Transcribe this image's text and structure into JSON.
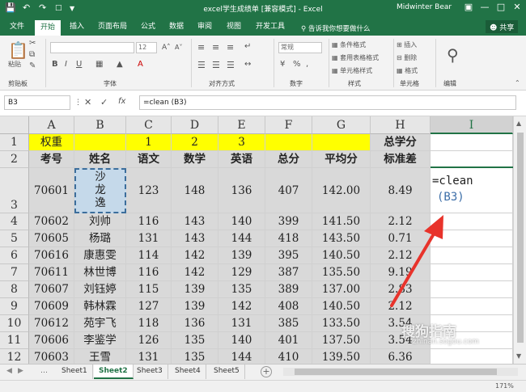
{
  "window": {
    "title": "excel学生成绩单 [兼容模式] - Excel",
    "user": "Midwinter Bear"
  },
  "ribbon": {
    "tabs": [
      "文件",
      "开始",
      "插入",
      "页面布局",
      "公式",
      "数据",
      "审阅",
      "视图",
      "开发工具"
    ],
    "active_tab": "开始",
    "tell_me": "告诉我你想要做什么",
    "share": "共享",
    "groups": {
      "clipboard": "剪贴板",
      "font": "字体",
      "alignment": "对齐方式",
      "number": "数字",
      "styles": "样式",
      "cells": "单元格",
      "editing": "编辑"
    },
    "paste": "粘贴",
    "font_size": "12",
    "number_format": "常规",
    "styles_items": [
      "条件格式",
      "套用表格格式",
      "单元格样式"
    ],
    "cells_items": [
      "插入",
      "删除",
      "格式"
    ]
  },
  "formula_bar": {
    "name_box": "B3",
    "formula": "=clean (B3)"
  },
  "columns": [
    "A",
    "B",
    "C",
    "D",
    "E",
    "F",
    "G",
    "H",
    "I"
  ],
  "selected_column": "I",
  "rows": [
    "1",
    "2",
    "3",
    "4",
    "5",
    "6",
    "7",
    "8",
    "9",
    "10",
    "11",
    "12"
  ],
  "sheet": {
    "row1": {
      "weight_label": "权重",
      "c": "1",
      "d": "2",
      "e": "3",
      "h": "总学分"
    },
    "headers": [
      "考号",
      "姓名",
      "语文",
      "数学",
      "英语",
      "总分",
      "平均分",
      "标准差"
    ],
    "data": [
      [
        "70601",
        "沙\n龙\n逸",
        "123",
        "148",
        "136",
        "407",
        "142.00",
        "8.49"
      ],
      [
        "70602",
        "刘帅",
        "116",
        "143",
        "140",
        "399",
        "141.50",
        "2.12"
      ],
      [
        "70605",
        "杨璐",
        "131",
        "143",
        "144",
        "418",
        "143.50",
        "0.71"
      ],
      [
        "70616",
        "康惠雯",
        "114",
        "142",
        "139",
        "395",
        "140.50",
        "2.12"
      ],
      [
        "70611",
        "林世博",
        "116",
        "142",
        "129",
        "387",
        "135.50",
        "9.19"
      ],
      [
        "70607",
        "刘钰婷",
        "115",
        "139",
        "135",
        "389",
        "137.00",
        "2.83"
      ],
      [
        "70609",
        "韩林霖",
        "127",
        "139",
        "142",
        "408",
        "140.50",
        "2.12"
      ],
      [
        "70612",
        "苑宇飞",
        "118",
        "136",
        "131",
        "385",
        "133.50",
        "3.54"
      ],
      [
        "70606",
        "李鉴学",
        "126",
        "135",
        "140",
        "401",
        "137.50",
        "3.54"
      ],
      [
        "70603",
        "王雪",
        "131",
        "135",
        "144",
        "410",
        "139.50",
        "6.36"
      ]
    ],
    "edit_cell_line1": "=clean",
    "edit_cell_line2": "(B3)"
  },
  "sheet_tabs": [
    "Sheet1",
    "Sheet2",
    "Sheet3",
    "Sheet4",
    "Sheet5"
  ],
  "active_sheet": "Sheet2",
  "status": {
    "zoom": "171%"
  },
  "watermark": {
    "main": "搜狗指南",
    "sub": "zhinan.sogou.com"
  },
  "colors": {
    "excel_green": "#217346",
    "header_yellow": "#ffff00",
    "arrow_red": "#e8332b"
  }
}
